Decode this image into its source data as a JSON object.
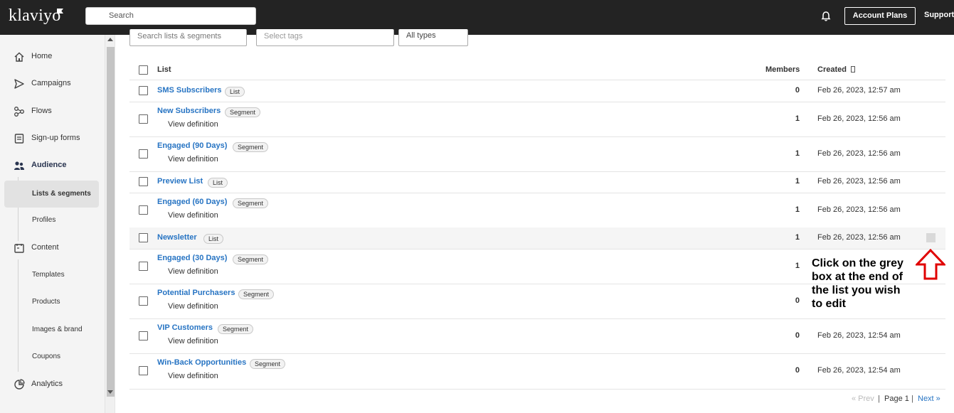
{
  "brand": {
    "logo_text": "klaviyo",
    "accent": "#2774c3",
    "topbar_bg": "#232323"
  },
  "header": {
    "search_placeholder": "Search",
    "account_button": "Account Plans",
    "support": "Support"
  },
  "sidebar": {
    "items": [
      {
        "label": "Home",
        "icon": "home-icon"
      },
      {
        "label": "Campaigns",
        "icon": "send-icon"
      },
      {
        "label": "Flows",
        "icon": "flows-icon"
      },
      {
        "label": "Sign-up forms",
        "icon": "form-icon"
      },
      {
        "label": "Audience",
        "icon": "people-icon"
      },
      {
        "label": "Content",
        "icon": "content-icon"
      },
      {
        "label": "Analytics",
        "icon": "pie-chart-icon"
      }
    ],
    "audience_sub": [
      "Lists & segments",
      "Profiles"
    ],
    "content_sub": [
      "Templates",
      "Products",
      "Images & brand",
      "Coupons"
    ]
  },
  "filters": {
    "search_placeholder": "Search lists & segments",
    "tags_placeholder": "Select tags",
    "types_value": "All types"
  },
  "table": {
    "headers": {
      "name": "List",
      "members": "Members",
      "created": "Created"
    },
    "view_definition_label": "View definition",
    "rows": [
      {
        "name": "SMS Subscribers",
        "type": "List",
        "members": "0",
        "created": "Feb 26, 2023, 12:57 am"
      },
      {
        "name": "New Subscribers",
        "type": "Segment",
        "members": "1",
        "created": "Feb 26, 2023, 12:56 am"
      },
      {
        "name": "Engaged (90 Days)",
        "type": "Segment",
        "members": "1",
        "created": "Feb 26, 2023, 12:56 am"
      },
      {
        "name": "Preview List",
        "type": "List",
        "members": "1",
        "created": "Feb 26, 2023, 12:56 am"
      },
      {
        "name": "Engaged (60 Days)",
        "type": "Segment",
        "members": "1",
        "created": "Feb 26, 2023, 12:56 am"
      },
      {
        "name": "Newsletter",
        "type": "List",
        "members": "1",
        "created": "Feb 26, 2023, 12:56 am"
      },
      {
        "name": "Engaged (30 Days)",
        "type": "Segment",
        "members": "1",
        "created": ""
      },
      {
        "name": "Potential Purchasers",
        "type": "Segment",
        "members": "0",
        "created": ""
      },
      {
        "name": "VIP Customers",
        "type": "Segment",
        "members": "0",
        "created": "Feb 26, 2023, 12:54 am"
      },
      {
        "name": "Win-Back Opportunities",
        "type": "Segment",
        "members": "0",
        "created": "Feb 26, 2023, 12:54 am"
      }
    ]
  },
  "annotation": {
    "text": "Click on the grey box at the end of the list you wish to edit",
    "arrow_color": "#e00000"
  },
  "pagination": {
    "prev": "« Prev",
    "sep": "|",
    "page": "Page 1",
    "next": "Next »"
  }
}
